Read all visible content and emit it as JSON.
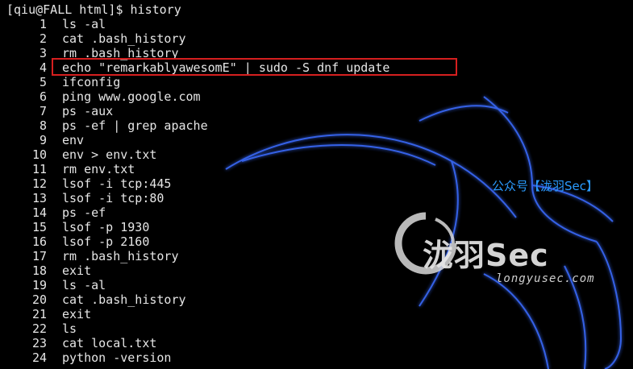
{
  "terminal": {
    "prompt": "[qiu@FALL html]$ history",
    "history": [
      {
        "num": "1",
        "cmd": "ls -al"
      },
      {
        "num": "2",
        "cmd": "cat .bash_history"
      },
      {
        "num": "3",
        "cmd": "rm .bash_history"
      },
      {
        "num": "4",
        "cmd": "echo \"remarkablyawesomE\" | sudo -S dnf update"
      },
      {
        "num": "5",
        "cmd": "ifconfig"
      },
      {
        "num": "6",
        "cmd": "ping www.google.com"
      },
      {
        "num": "7",
        "cmd": "ps -aux"
      },
      {
        "num": "8",
        "cmd": "ps -ef | grep apache"
      },
      {
        "num": "9",
        "cmd": "env"
      },
      {
        "num": "10",
        "cmd": "env > env.txt"
      },
      {
        "num": "11",
        "cmd": "rm env.txt"
      },
      {
        "num": "12",
        "cmd": "lsof -i tcp:445"
      },
      {
        "num": "13",
        "cmd": "lsof -i tcp:80"
      },
      {
        "num": "14",
        "cmd": "ps -ef"
      },
      {
        "num": "15",
        "cmd": "lsof -p 1930"
      },
      {
        "num": "16",
        "cmd": "lsof -p 2160"
      },
      {
        "num": "17",
        "cmd": "rm .bash_history"
      },
      {
        "num": "18",
        "cmd": "exit"
      },
      {
        "num": "19",
        "cmd": "ls -al"
      },
      {
        "num": "20",
        "cmd": "cat .bash_history"
      },
      {
        "num": "21",
        "cmd": "exit"
      },
      {
        "num": "22",
        "cmd": "ls"
      },
      {
        "num": "23",
        "cmd": "cat local.txt"
      },
      {
        "num": "24",
        "cmd": "python -version"
      }
    ],
    "highlighted_entry": "4"
  },
  "watermark": {
    "wechat_label": "公众号【泷羽Sec】",
    "brand": "泷羽Sec",
    "url": "longyusec.com"
  },
  "colors": {
    "background": "#000000",
    "text": "#e6e6e6",
    "highlight_border": "#d61f1f",
    "watermark_blue": "#2a9bff",
    "dragon_glow": "#3a6cff"
  }
}
